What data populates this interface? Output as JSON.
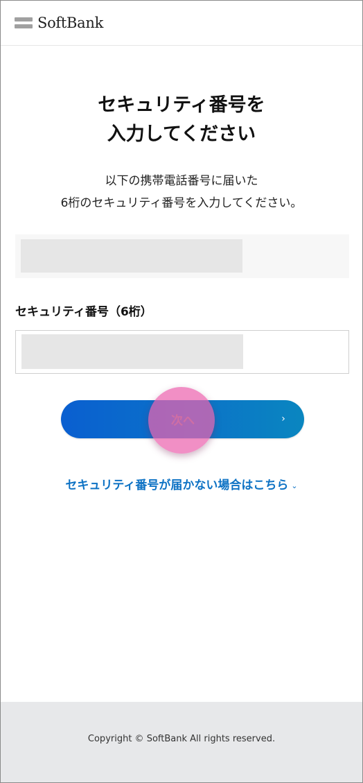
{
  "header": {
    "logo_text": "SoftBank",
    "logo_icon": "softbank-bars-icon",
    "logo_bar_color": "#a0a0a0"
  },
  "main": {
    "title_line1": "セキュリティ番号を",
    "title_line2": "入力してください",
    "description_line1": "以下の携帯電話番号に届いた",
    "description_line2": "6桁のセキュリティ番号を入力してください。",
    "phone_number": "",
    "code_field": {
      "label": "セキュリティ番号（6桁）",
      "value": "",
      "placeholder": ""
    },
    "next_button": {
      "label": "次へ",
      "chevron": "›",
      "gradient_start": "#0a5fd0",
      "gradient_end": "#0a86c0"
    },
    "help_link": {
      "label": "セキュリティ番号が届かない場合はこちら",
      "chevron": "⌄",
      "color": "#0d72c4"
    }
  },
  "footer": {
    "copyright": "Copyright © SoftBank All rights reserved."
  },
  "colors": {
    "tap_indicator": "#ec64af"
  }
}
